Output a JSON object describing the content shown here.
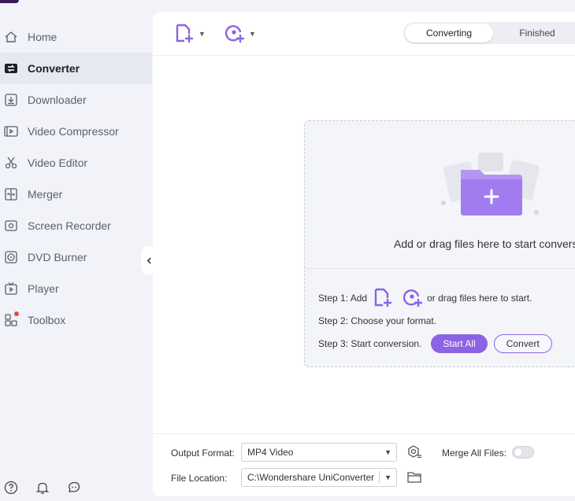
{
  "sidebar": {
    "items": [
      {
        "label": "Home",
        "icon": "home-icon"
      },
      {
        "label": "Converter",
        "icon": "converter-icon"
      },
      {
        "label": "Downloader",
        "icon": "downloader-icon"
      },
      {
        "label": "Video Compressor",
        "icon": "video-compressor-icon"
      },
      {
        "label": "Video Editor",
        "icon": "scissors-icon"
      },
      {
        "label": "Merger",
        "icon": "merger-icon"
      },
      {
        "label": "Screen Recorder",
        "icon": "screen-recorder-icon"
      },
      {
        "label": "DVD Burner",
        "icon": "dvd-icon"
      },
      {
        "label": "Player",
        "icon": "player-icon"
      },
      {
        "label": "Toolbox",
        "icon": "toolbox-icon"
      }
    ],
    "active": "Converter",
    "bottom_icons": [
      "help-icon",
      "bell-icon",
      "feedback-icon"
    ]
  },
  "toolbar": {
    "tabs": [
      {
        "label": "Converting",
        "active": true
      },
      {
        "label": "Finished",
        "active": false
      }
    ]
  },
  "dropzone": {
    "prompt": "Add or drag files here to start convers",
    "step1_prefix": "Step 1: Add",
    "step1_suffix": "or drag files here to start.",
    "step2": "Step 2: Choose your format.",
    "step3": "Step 3: Start conversion.",
    "start_all_label": "Start All",
    "convert_label": "Convert"
  },
  "footer": {
    "output_format_label": "Output Format:",
    "output_format_value": "MP4 Video",
    "merge_label": "Merge All Files:",
    "merge_enabled": false,
    "file_location_label": "File Location:",
    "file_location_value": "C:\\Wondershare UniConverter"
  },
  "colors": {
    "accent": "#8b63e6",
    "sidebar_bg": "#f1f3f9",
    "panel_bg": "#ffffff",
    "notification_dot": "#e84545"
  }
}
